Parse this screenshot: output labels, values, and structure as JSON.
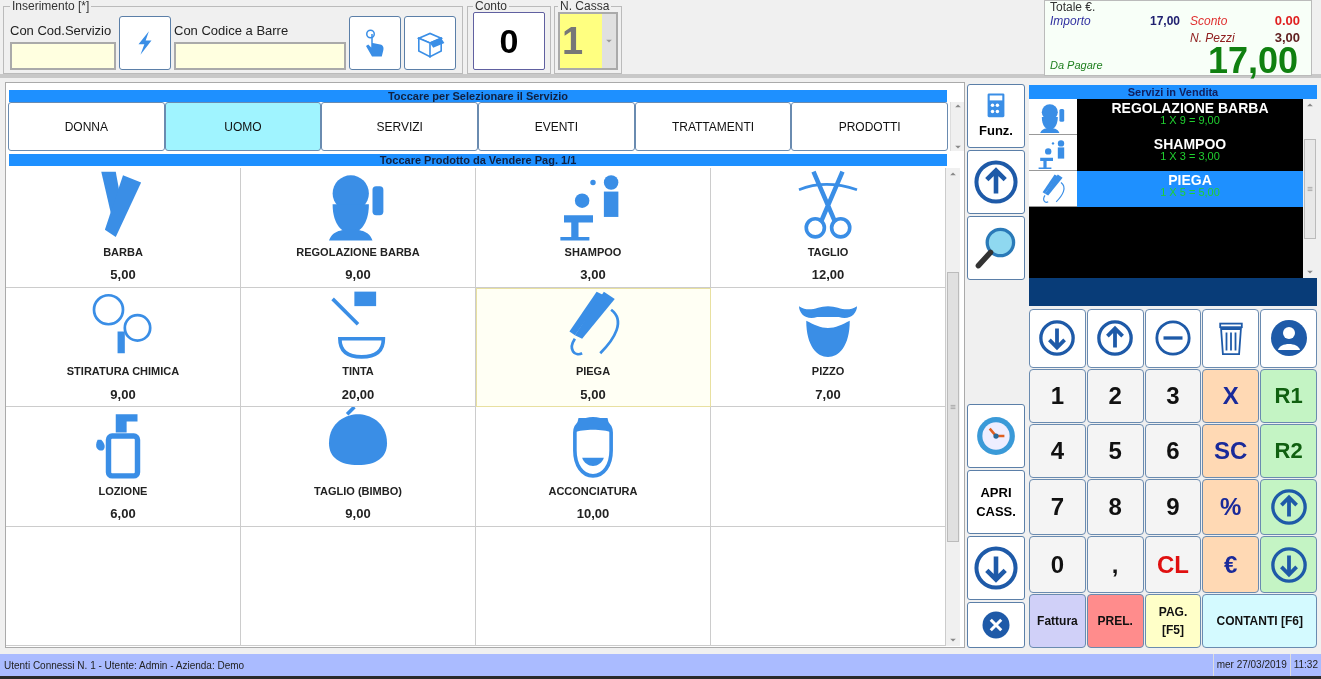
{
  "entry": {
    "title": "Inserimento [*]",
    "service_code": {
      "label": "Con Cod.Servizio"
    },
    "barcode": {
      "label": "Con Codice a Barre"
    }
  },
  "account": {
    "title": "Conto",
    "value": "0"
  },
  "register": {
    "title": "N. Cassa",
    "value": "1"
  },
  "totals": {
    "title": "Totale €.",
    "amount_label": "Importo",
    "amount": "17,00",
    "discount_label": "Sconto",
    "discount": "0.00",
    "pieces_label": "N. Pezzi",
    "pieces": "3,00",
    "due_label": "Da Pagare",
    "due": "17,00"
  },
  "categories": {
    "header": "Toccare per Selezionare il Servizio",
    "tabs": [
      {
        "label": "DONNA",
        "selected": false
      },
      {
        "label": "UOMO",
        "selected": true
      },
      {
        "label": "SERVIZI",
        "selected": false
      },
      {
        "label": "EVENTI",
        "selected": false
      },
      {
        "label": "TRATTAMENTI",
        "selected": false
      },
      {
        "label": "PRODOTTI",
        "selected": false
      }
    ]
  },
  "products": {
    "header": "Toccare Prodotto da Vendere Pag. 1/1",
    "items": [
      {
        "name": "BARBA",
        "price": "5,00",
        "selected": false
      },
      {
        "name": "REGOLAZIONE BARBA",
        "price": "9,00",
        "selected": false
      },
      {
        "name": "SHAMPOO",
        "price": "3,00",
        "selected": false
      },
      {
        "name": "TAGLIO",
        "price": "12,00",
        "selected": false
      },
      {
        "name": "STIRATURA CHIMICA",
        "price": "9,00",
        "selected": false
      },
      {
        "name": "TINTA",
        "price": "20,00",
        "selected": false
      },
      {
        "name": "PIEGA",
        "price": "5,00",
        "selected": true
      },
      {
        "name": "PIZZO",
        "price": "7,00",
        "selected": false
      },
      {
        "name": "LOZIONE",
        "price": "6,00",
        "selected": false
      },
      {
        "name": "TAGLIO (BIMBO)",
        "price": "9,00",
        "selected": false
      },
      {
        "name": "ACCONCIATURA",
        "price": "10,00",
        "selected": false
      }
    ]
  },
  "side_buttons": [
    {
      "kind": "functions",
      "label": "Funz."
    },
    {
      "kind": "up"
    },
    {
      "kind": "search"
    },
    {
      "kind": "spacer"
    },
    {
      "kind": "clock"
    },
    {
      "kind": "text",
      "label": "APRI CASS."
    },
    {
      "kind": "down"
    },
    {
      "kind": "close"
    }
  ],
  "sale": {
    "header": "Servizi in Vendita",
    "items": [
      {
        "name": "REGOLAZIONE BARBA",
        "line": "1 X 9 = 9,00",
        "selected": false
      },
      {
        "name": "SHAMPOO",
        "line": "1 X 3 = 3,00",
        "selected": false
      },
      {
        "name": "PIEGA",
        "line": "1 X 5 = 5,00",
        "selected": true
      }
    ]
  },
  "keypad": [
    {
      "kind": "icon-down"
    },
    {
      "kind": "icon-up"
    },
    {
      "kind": "icon-minus"
    },
    {
      "kind": "icon-trash"
    },
    {
      "kind": "icon-person"
    },
    {
      "kind": "digit",
      "label": "1"
    },
    {
      "kind": "digit",
      "label": "2"
    },
    {
      "kind": "digit",
      "label": "3"
    },
    {
      "kind": "op",
      "label": "X"
    },
    {
      "kind": "reg",
      "label": "R1"
    },
    {
      "kind": "digit",
      "label": "4"
    },
    {
      "kind": "digit",
      "label": "5"
    },
    {
      "kind": "digit",
      "label": "6"
    },
    {
      "kind": "op",
      "label": "SC"
    },
    {
      "kind": "reg",
      "label": "R2"
    },
    {
      "kind": "digit",
      "label": "7"
    },
    {
      "kind": "digit",
      "label": "8"
    },
    {
      "kind": "digit",
      "label": "9"
    },
    {
      "kind": "op",
      "label": "%"
    },
    {
      "kind": "green-up"
    },
    {
      "kind": "digit",
      "label": "0"
    },
    {
      "kind": "digit",
      "label": ","
    },
    {
      "kind": "clear",
      "label": "CL"
    },
    {
      "kind": "op",
      "label": "€"
    },
    {
      "kind": "green-down"
    },
    {
      "kind": "invoice",
      "label": "Fattura"
    },
    {
      "kind": "withdraw",
      "label": "PREL."
    },
    {
      "kind": "pay",
      "label": "PAG. [F5]"
    },
    {
      "kind": "cash",
      "label": "CONTANTI [F6]"
    }
  ],
  "status_bar": {
    "info": "Utenti Connessi N. 1 - Utente: Admin - Azienda: Demo",
    "date": "mer 27/03/2019",
    "time": "11:32"
  }
}
